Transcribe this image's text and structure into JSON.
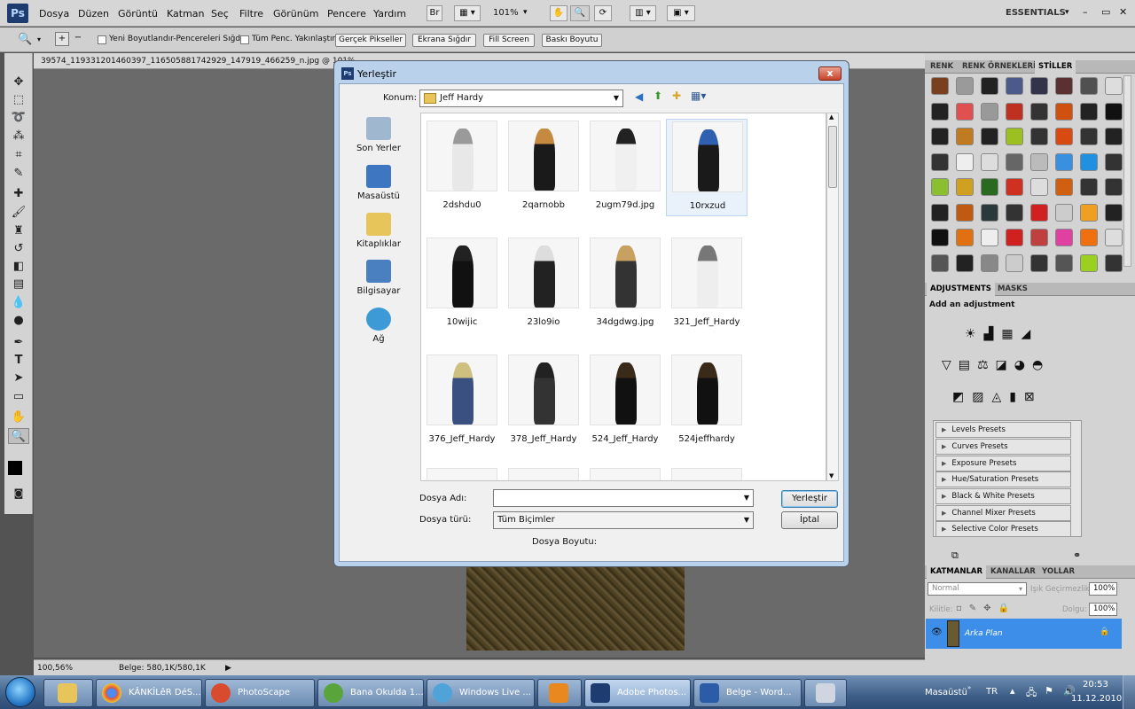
{
  "menubar": {
    "logo": "Ps",
    "menus": [
      "Dosya",
      "Düzen",
      "Görüntü",
      "Katman",
      "Seç",
      "Filtre",
      "Görünüm",
      "Pencere",
      "Yardım"
    ],
    "bridge_btn": "Br",
    "zoom": "101%",
    "workspace": "ESSENTIALS",
    "window_controls": [
      "–",
      "▭",
      "✕"
    ]
  },
  "options": {
    "resize_windows": "Yeni Boyutlandır-Pencereleri Sığdır",
    "zoom_all": "Tüm Penc. Yakınlaştır",
    "buttons": [
      "Gerçek Pikseller",
      "Ekrana Sığdır",
      "Fill Screen",
      "Baskı Boyutu"
    ]
  },
  "document": {
    "tab_title": "39574_119331201460397_116505881742929_147919_466259_n.jpg @ 101%"
  },
  "status": {
    "zoom": "100,56%",
    "doc_size": "Belge: 580,1K/580,1K"
  },
  "panels": {
    "swatches_tabs": [
      "RENK",
      "RENK ÖRNEKLERİ",
      "STİLLER"
    ],
    "adj_tabs": [
      "ADJUSTMENTS",
      "MASKS"
    ],
    "adj_title": "Add an adjustment",
    "presets": [
      "Levels Presets",
      "Curves Presets",
      "Exposure Presets",
      "Hue/Saturation Presets",
      "Black & White Presets",
      "Channel Mixer Presets",
      "Selective Color Presets"
    ],
    "layer_tabs": [
      "KATMANLAR",
      "KANALLAR",
      "YOLLAR"
    ],
    "blend_mode": "Normal",
    "opacity_label": "Işık Geçirmezlik:",
    "opacity": "100%",
    "lock_label": "Kilitle:",
    "fill_label": "Dolgu:",
    "fill": "100%",
    "layer_name": "Arka Plan"
  },
  "dialog": {
    "title": "Yerleştir",
    "close": "x",
    "location_label": "Konum:",
    "location": "Jeff Hardy",
    "nav": [
      "Son Yerler",
      "Masaüstü",
      "Kitaplıklar",
      "Bilgisayar",
      "Ağ"
    ],
    "files": [
      "2dshdu0",
      "2qarnobb",
      "2ugm79d.jpg",
      "10rxzud",
      "10wijic",
      "23lo9io",
      "34dgdwg.jpg",
      "321_Jeff_Hardy",
      "376_Jeff_Hardy",
      "378_Jeff_Hardy",
      "524_Jeff_Hardy",
      "524jeffhardy"
    ],
    "filename_label": "Dosya Adı:",
    "filename_value": "",
    "filetype_label": "Dosya türü:",
    "filetype_value": "Tüm Biçimler",
    "filesize_label": "Dosya Boyutu:",
    "place_button": "Yerleştir",
    "cancel_button": "İptal"
  },
  "taskbar": {
    "items": [
      "KÂNKİLêR DéS...",
      "PhotoScape",
      "Bana Okulda 1...",
      "Windows Live ...",
      "",
      "Adobe Photos...",
      "Belge - Word...",
      ""
    ],
    "tray_label": "Masaüstü",
    "lang": "TR",
    "time": "20:53",
    "date": "11.12.2010"
  },
  "colors": {
    "photoshop_blue": "#1f3c70",
    "layer_selected": "#3c8ee8",
    "dialog_frame": "#b9d1ea"
  }
}
